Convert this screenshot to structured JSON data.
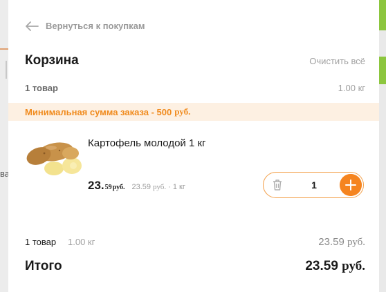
{
  "background": {
    "left_text": "ва"
  },
  "nav": {
    "back_label": "Вернуться к покупкам"
  },
  "cart": {
    "title": "Корзина",
    "clear_label": "Очистить всё",
    "count_label": "1 товар",
    "weight_label": "1.00 кг"
  },
  "min_order": {
    "text": "Минимальная сумма заказа - 500",
    "currency": "руб."
  },
  "item": {
    "image_icon": "potato-image",
    "name": "Картофель молодой 1 кг",
    "price_int": "23.",
    "price_frac": "59",
    "price_currency": "руб.",
    "unit_price": "23.59",
    "unit_currency": "руб.",
    "unit_suffix": " · 1 кг",
    "quantity": "1",
    "delete_icon": "trash-icon",
    "increase_icon": "plus-icon"
  },
  "footer": {
    "count_label": "1 товар",
    "weight_label": "1.00 кг",
    "subtotal": "23.59",
    "subtotal_currency": "руб.",
    "total_label": "Итого",
    "total_value": "23.59",
    "total_currency": "руб."
  },
  "colors": {
    "accent": "#f5841f",
    "min_order_bg": "#fdf0e2",
    "min_order_text": "#f08a1c",
    "muted_text": "#a0a0a0"
  }
}
